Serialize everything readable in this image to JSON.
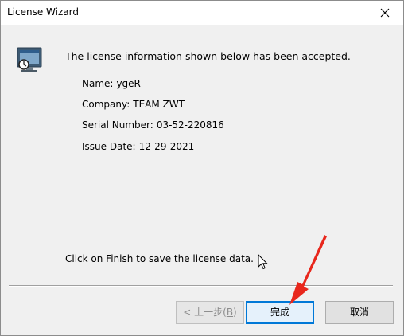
{
  "window": {
    "title": "License Wizard"
  },
  "icons": {
    "close": "close-icon",
    "app": "license-computer-icon",
    "cursor": "mouse-cursor-icon",
    "annotation": "red-arrow-annotation"
  },
  "message": "The license information shown below has been accepted.",
  "license": {
    "name_label": "Name:",
    "name": "ygeR",
    "company_label": "Company:",
    "company": "TEAM ZWT",
    "serial_label": "Serial Number:",
    "serial": "03-52-220816",
    "issue_label": "Issue Date:",
    "issue": "12-29-2021"
  },
  "finish_message": "Click on Finish to save the license data.",
  "buttons": {
    "back_prefix": "< 上一步(",
    "back_key": "B",
    "back_suffix": ")",
    "finish": "完成",
    "cancel": "取消"
  },
  "colors": {
    "focus_border": "#0078d7",
    "arrow": "#e8271c",
    "dialog_bg": "#f0f0f0"
  }
}
